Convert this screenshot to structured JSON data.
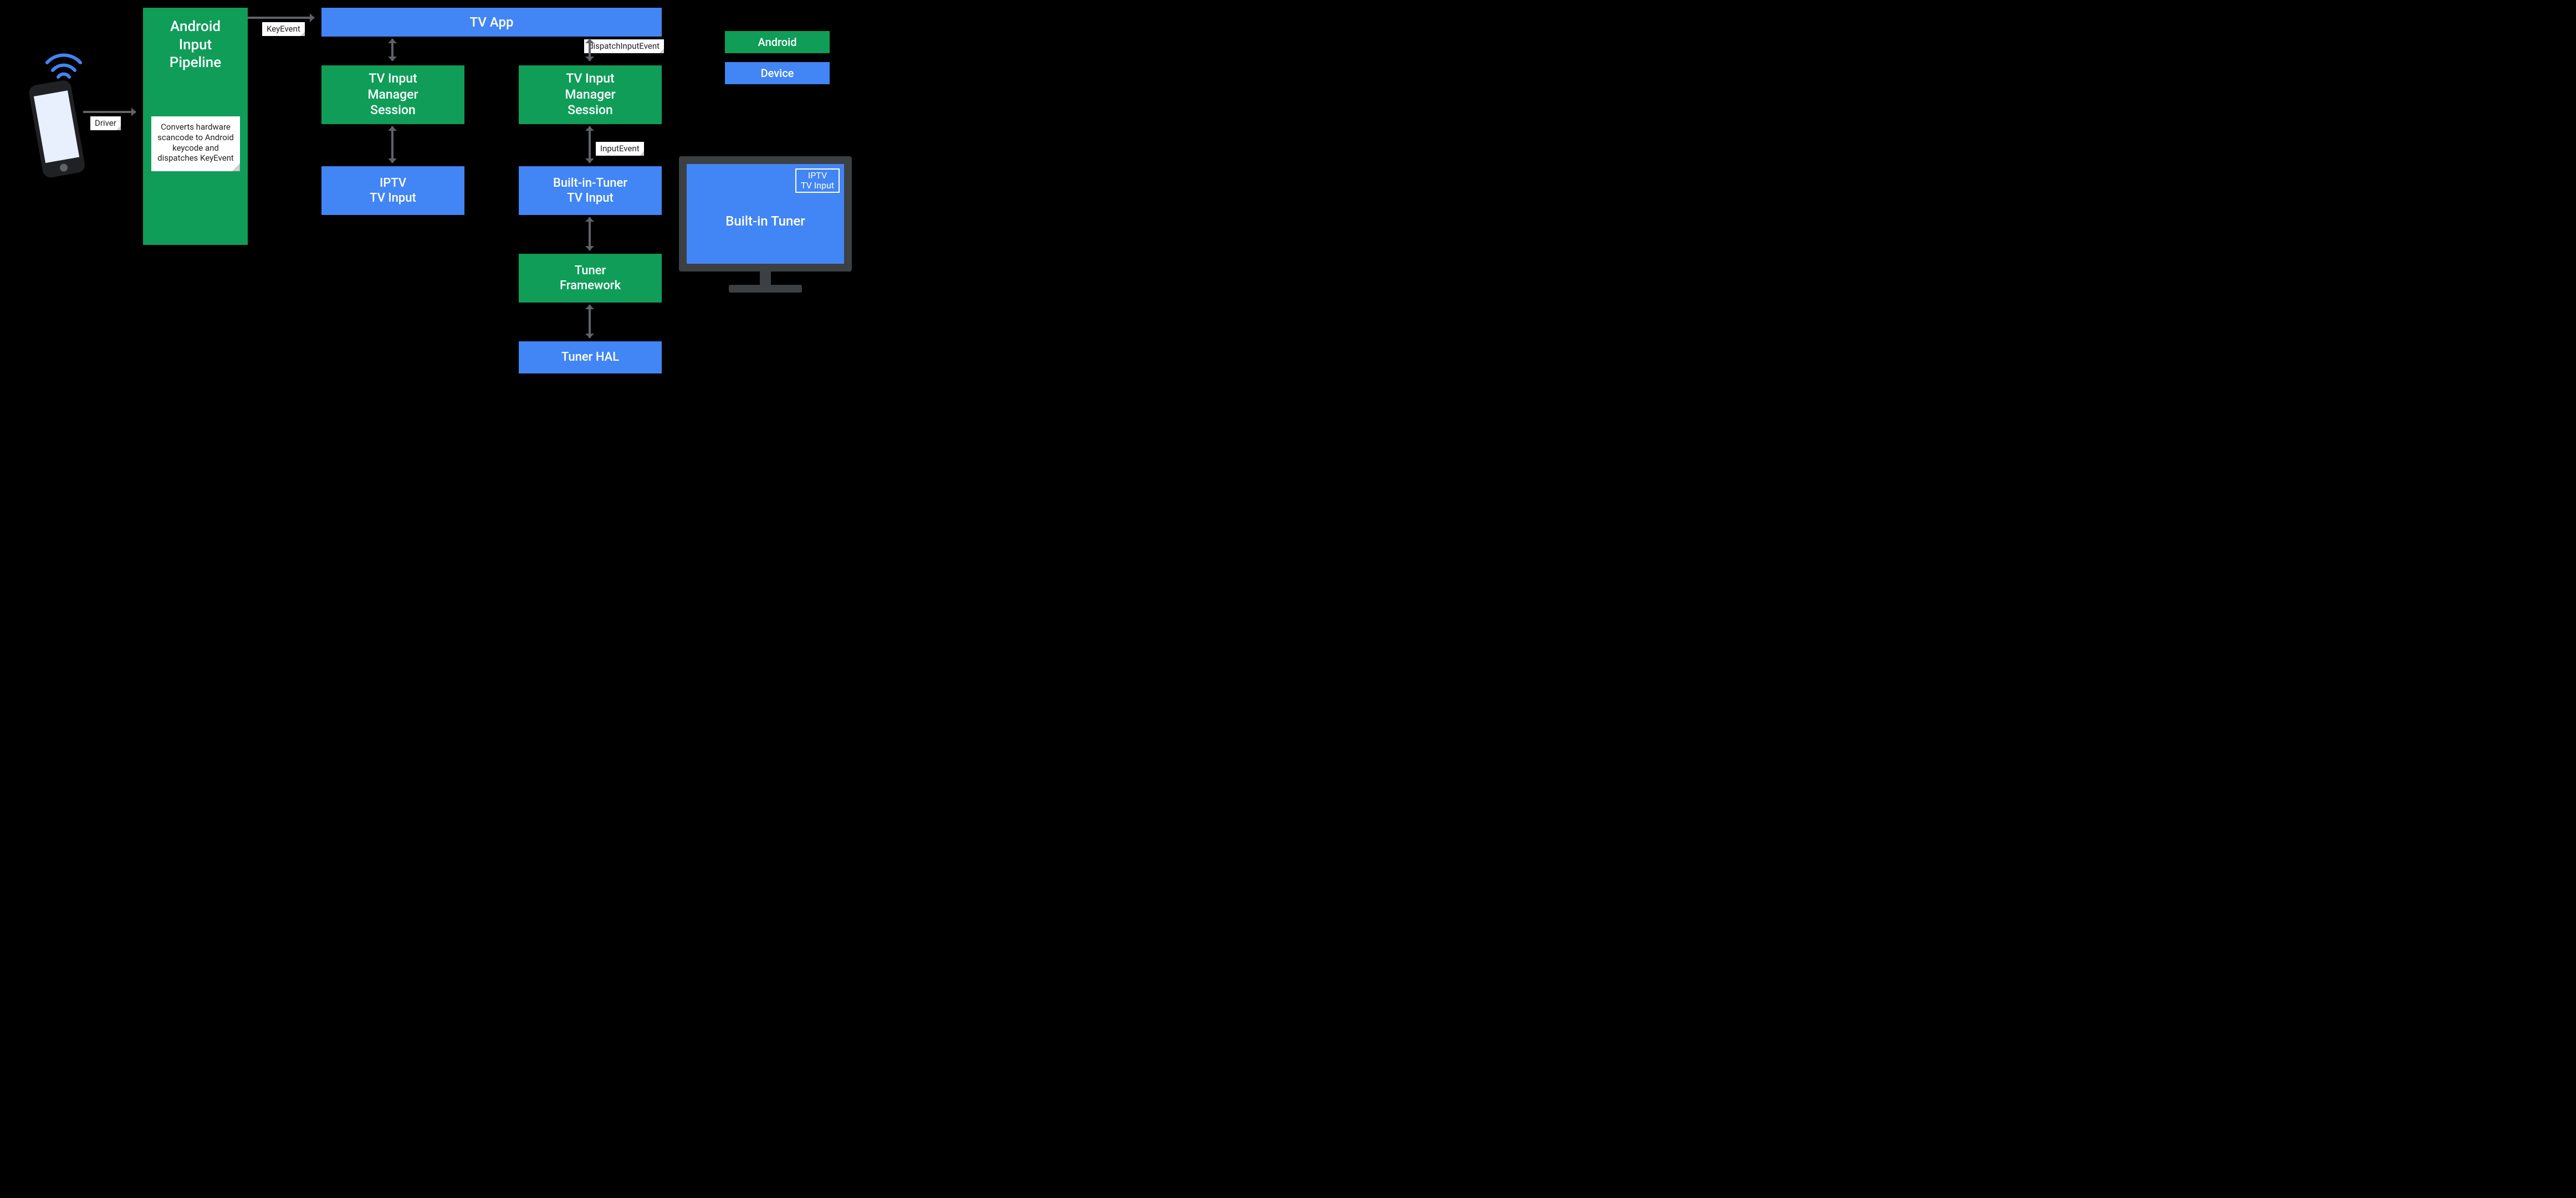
{
  "legend": {
    "android": "Android",
    "device": "Device"
  },
  "phone_to_pipeline_tag": "Driver",
  "pipeline": {
    "title": "Android\nInput\nPipeline",
    "note": "Converts hardware scancode to Android keycode and dispatches KeyEvent"
  },
  "pipeline_to_tvapp_tag": "KeyEvent",
  "tv_app": "TV App",
  "tvapp_to_session2_tag": "dispatchInputEvent",
  "session_left": "TV Input\nManager\nSession",
  "session_right": "TV Input\nManager\nSession",
  "session_to_builtin_tag": "InputEvent",
  "iptv_input": "IPTV\nTV Input",
  "builtin_input": "Built-in-Tuner\nTV Input",
  "tuner_framework": "Tuner\nFramework",
  "tuner_hal": "Tuner HAL",
  "monitor": {
    "main": "Built-in Tuner",
    "inset": "IPTV\nTV Input"
  },
  "colors": {
    "android": "#0F9D58",
    "device": "#4285F4",
    "connector": "#5F6368"
  }
}
